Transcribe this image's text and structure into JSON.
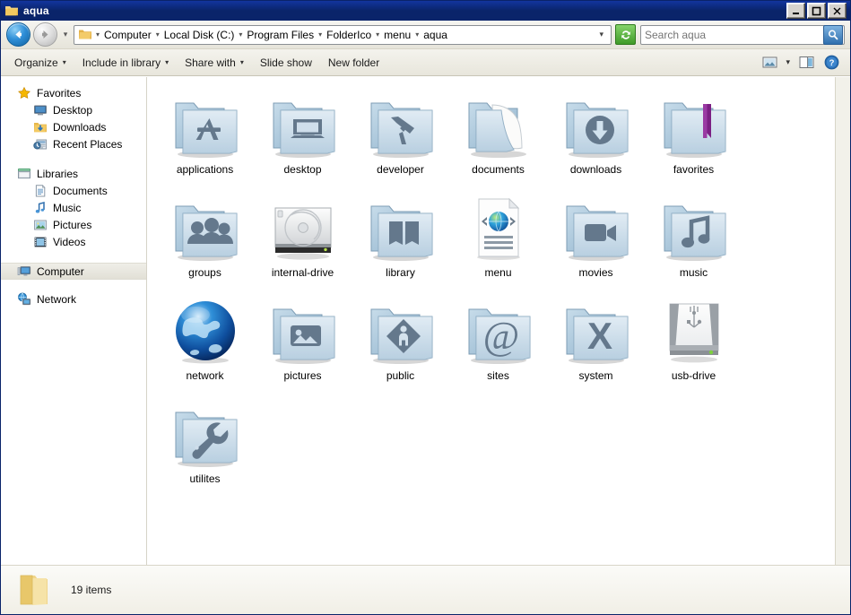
{
  "window": {
    "title": "aqua",
    "title_icon": "folder-icon",
    "controls": [
      {
        "name": "minimize-button",
        "glyph": "minimize-icon"
      },
      {
        "name": "maximize-button",
        "glyph": "maximize-icon"
      },
      {
        "name": "close-button",
        "glyph": "close-icon"
      }
    ]
  },
  "address_bar": {
    "back_label": "Back",
    "forward_label": "Forward",
    "recent_pages_label": "Recent Pages",
    "breadcrumbs": [
      "Computer",
      "Local Disk (C:)",
      "Program Files",
      "FolderIco",
      "menu",
      "aqua"
    ],
    "separator": "▸",
    "dropdown_glyph": "▾",
    "refresh_label": "Refresh",
    "refresh_icon": "refresh-icon"
  },
  "search": {
    "placeholder": "Search aqua",
    "value": "",
    "icon": "search-icon"
  },
  "toolbar": {
    "items": [
      {
        "label": "Organize",
        "has_dropdown": true,
        "name": "organize-button"
      },
      {
        "label": "Include in library",
        "has_dropdown": true,
        "name": "include-in-library-button"
      },
      {
        "label": "Share with",
        "has_dropdown": true,
        "name": "share-with-button"
      },
      {
        "label": "Slide show",
        "has_dropdown": false,
        "name": "slide-show-button"
      },
      {
        "label": "New folder",
        "has_dropdown": false,
        "name": "new-folder-button"
      }
    ],
    "dropdown_glyph": "▾",
    "view_icon": "change-view-icon",
    "view_dropdown_glyph": "▾",
    "preview_icon": "preview-pane-icon",
    "help_icon": "help-icon"
  },
  "sidebar": {
    "groups": [
      {
        "header": {
          "label": "Favorites",
          "icon": "star-icon",
          "name": "sidebar-group-favorites"
        },
        "items": [
          {
            "label": "Desktop",
            "icon": "desktop-icon",
            "name": "sidebar-item-desktop"
          },
          {
            "label": "Downloads",
            "icon": "downloads-icon",
            "name": "sidebar-item-downloads"
          },
          {
            "label": "Recent Places",
            "icon": "recent-places-icon",
            "name": "sidebar-item-recent-places"
          }
        ]
      },
      {
        "header": {
          "label": "Libraries",
          "icon": "libraries-icon",
          "name": "sidebar-group-libraries"
        },
        "items": [
          {
            "label": "Documents",
            "icon": "documents-icon",
            "name": "sidebar-item-documents"
          },
          {
            "label": "Music",
            "icon": "music-icon",
            "name": "sidebar-item-music"
          },
          {
            "label": "Pictures",
            "icon": "pictures-icon",
            "name": "sidebar-item-pictures"
          },
          {
            "label": "Videos",
            "icon": "videos-icon",
            "name": "sidebar-item-videos"
          }
        ]
      },
      {
        "header": {
          "label": "Computer",
          "icon": "computer-icon",
          "name": "sidebar-group-computer",
          "selected": true
        },
        "items": []
      },
      {
        "header": {
          "label": "Network",
          "icon": "network-icon",
          "name": "sidebar-group-network"
        },
        "items": []
      }
    ]
  },
  "files": [
    {
      "label": "applications",
      "icon": "folder-applications-icon",
      "type": "folder",
      "glyph": "applications"
    },
    {
      "label": "desktop",
      "icon": "folder-desktop-icon",
      "type": "folder",
      "glyph": "desktop"
    },
    {
      "label": "developer",
      "icon": "folder-developer-icon",
      "type": "folder",
      "glyph": "hammer"
    },
    {
      "label": "documents",
      "icon": "folder-documents-icon",
      "type": "folder",
      "glyph": "documents"
    },
    {
      "label": "downloads",
      "icon": "folder-downloads-icon",
      "type": "folder",
      "glyph": "download-arrow"
    },
    {
      "label": "favorites",
      "icon": "folder-favorites-icon",
      "type": "folder",
      "glyph": "ribbon"
    },
    {
      "label": "groups",
      "icon": "folder-groups-icon",
      "type": "folder",
      "glyph": "people"
    },
    {
      "label": "internal-drive",
      "icon": "internal-drive-icon",
      "type": "drive",
      "glyph": "hard-disk"
    },
    {
      "label": "library",
      "icon": "folder-library-icon",
      "type": "folder",
      "glyph": "book"
    },
    {
      "label": "menu",
      "icon": "html-document-icon",
      "type": "document",
      "glyph": "globe-document"
    },
    {
      "label": "movies",
      "icon": "folder-movies-icon",
      "type": "folder",
      "glyph": "video-camera"
    },
    {
      "label": "music",
      "icon": "folder-music-icon",
      "type": "folder",
      "glyph": "music-note"
    },
    {
      "label": "network",
      "icon": "network-globe-icon",
      "type": "globe",
      "glyph": "blue-globe"
    },
    {
      "label": "pictures",
      "icon": "folder-pictures-icon",
      "type": "folder",
      "glyph": "photo"
    },
    {
      "label": "public",
      "icon": "folder-public-icon",
      "type": "folder",
      "glyph": "public-person"
    },
    {
      "label": "sites",
      "icon": "folder-sites-icon",
      "type": "folder",
      "glyph": "at-sign"
    },
    {
      "label": "system",
      "icon": "folder-system-icon",
      "type": "folder",
      "glyph": "x-letter"
    },
    {
      "label": "usb-drive",
      "icon": "usb-drive-icon",
      "type": "drive",
      "glyph": "usb-disk"
    },
    {
      "label": "utilites",
      "icon": "folder-utilities-icon",
      "type": "folder",
      "glyph": "wrench"
    }
  ],
  "status": {
    "icon": "folder-icon",
    "text": "19 items"
  },
  "colors": {
    "titlebar": "#0a246a",
    "folder_front_light": "#d4e2ed",
    "folder_front_dark": "#9fbcd4",
    "folder_glyph": "#64788c",
    "ribbon": "#7b1f84",
    "chrome": "#f0efe8",
    "selection": "#e6e4da"
  }
}
